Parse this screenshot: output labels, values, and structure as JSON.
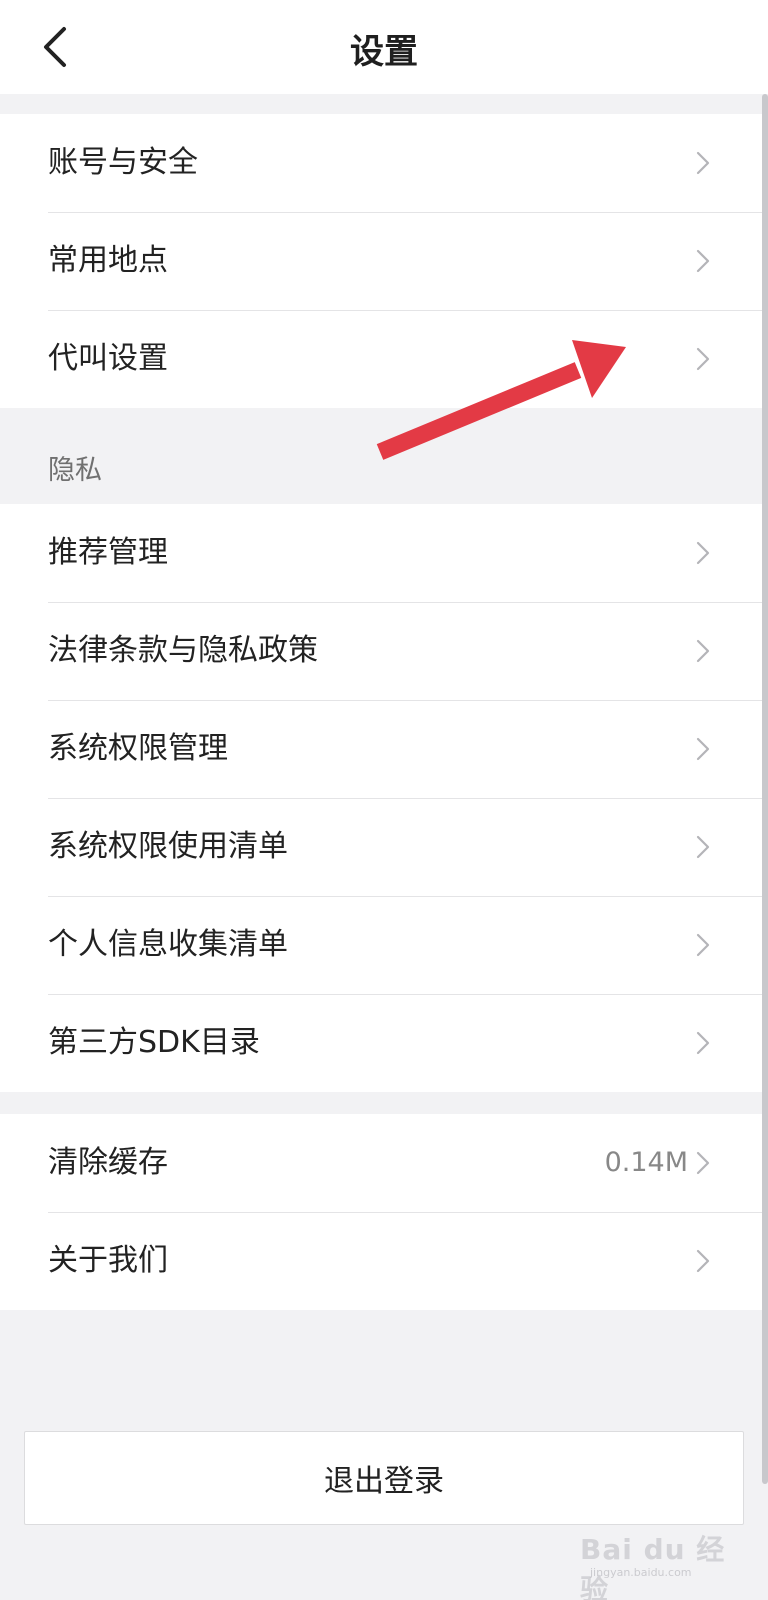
{
  "header": {
    "title": "设置",
    "back_icon": "chevron-left-icon"
  },
  "group1": {
    "items": [
      {
        "label": "账号与安全"
      },
      {
        "label": "常用地点"
      },
      {
        "label": "代叫设置"
      }
    ]
  },
  "privacy": {
    "section_label": "隐私",
    "items": [
      {
        "label": "推荐管理"
      },
      {
        "label": "法律条款与隐私政策"
      },
      {
        "label": "系统权限管理"
      },
      {
        "label": "系统权限使用清单"
      },
      {
        "label": "个人信息收集清单"
      },
      {
        "label": "第三方SDK目录"
      }
    ]
  },
  "group3": {
    "items": [
      {
        "label": "清除缓存",
        "value": "0.14M"
      },
      {
        "label": "关于我们"
      }
    ]
  },
  "logout": {
    "label": "退出登录"
  },
  "annotation": {
    "color": "#e33a45",
    "icon": "red-arrow-icon"
  },
  "watermark": {
    "text": "Bai du 经验",
    "sub": "jingyan.baidu.com"
  }
}
